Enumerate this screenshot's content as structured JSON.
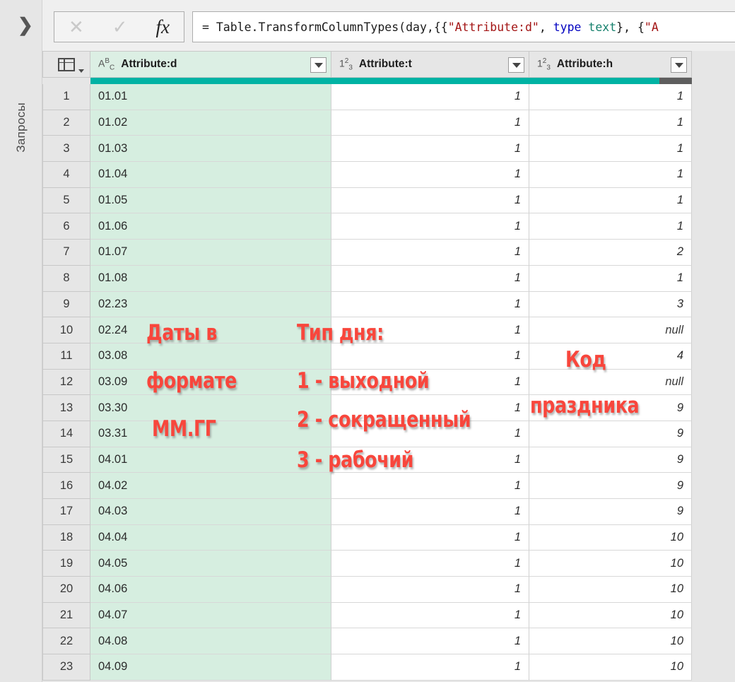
{
  "sidebar": {
    "expand_icon": "chevron-right-icon",
    "label": "Запросы"
  },
  "formula_bar": {
    "cancel_icon": "close-icon",
    "accept_icon": "check-icon",
    "fx_icon": "fx-icon",
    "formula_segments": [
      {
        "text": "= Table.TransformColumnTypes(day,{{",
        "style": "plain"
      },
      {
        "text": "\"Attribute:d\"",
        "style": "string"
      },
      {
        "text": ", ",
        "style": "plain"
      },
      {
        "text": "type",
        "style": "keyword"
      },
      {
        "text": " ",
        "style": "plain"
      },
      {
        "text": "text",
        "style": "type"
      },
      {
        "text": "}, {",
        "style": "plain"
      },
      {
        "text": "\"A",
        "style": "string"
      }
    ],
    "formula_full": "= Table.TransformColumnTypes(day,{{\"Attribute:d\", type text}, {\"A"
  },
  "table": {
    "select_all_icon": "table-select-all-icon",
    "columns": [
      {
        "name": "Attribute:d",
        "type_icon": "ABC",
        "type": "text",
        "selected": true,
        "quality_fill_pct": 100,
        "filter_icon": "filter-dropdown-icon"
      },
      {
        "name": "Attribute:t",
        "type_icon": "123",
        "type": "number",
        "selected": false,
        "quality_fill_pct": 100,
        "filter_icon": "filter-dropdown-icon"
      },
      {
        "name": "Attribute:h",
        "type_icon": "123",
        "type": "number",
        "selected": false,
        "quality_fill_pct": 80,
        "filter_icon": "filter-dropdown-icon"
      }
    ],
    "rows": [
      {
        "n": "1",
        "d": "01.01",
        "t": "1",
        "h": "1"
      },
      {
        "n": "2",
        "d": "01.02",
        "t": "1",
        "h": "1"
      },
      {
        "n": "3",
        "d": "01.03",
        "t": "1",
        "h": "1"
      },
      {
        "n": "4",
        "d": "01.04",
        "t": "1",
        "h": "1"
      },
      {
        "n": "5",
        "d": "01.05",
        "t": "1",
        "h": "1"
      },
      {
        "n": "6",
        "d": "01.06",
        "t": "1",
        "h": "1"
      },
      {
        "n": "7",
        "d": "01.07",
        "t": "1",
        "h": "2"
      },
      {
        "n": "8",
        "d": "01.08",
        "t": "1",
        "h": "1"
      },
      {
        "n": "9",
        "d": "02.23",
        "t": "1",
        "h": "3"
      },
      {
        "n": "10",
        "d": "02.24",
        "t": "1",
        "h": "null"
      },
      {
        "n": "11",
        "d": "03.08",
        "t": "1",
        "h": "4"
      },
      {
        "n": "12",
        "d": "03.09",
        "t": "1",
        "h": "null"
      },
      {
        "n": "13",
        "d": "03.30",
        "t": "1",
        "h": "9"
      },
      {
        "n": "14",
        "d": "03.31",
        "t": "1",
        "h": "9"
      },
      {
        "n": "15",
        "d": "04.01",
        "t": "1",
        "h": "9"
      },
      {
        "n": "16",
        "d": "04.02",
        "t": "1",
        "h": "9"
      },
      {
        "n": "17",
        "d": "04.03",
        "t": "1",
        "h": "9"
      },
      {
        "n": "18",
        "d": "04.04",
        "t": "1",
        "h": "10"
      },
      {
        "n": "19",
        "d": "04.05",
        "t": "1",
        "h": "10"
      },
      {
        "n": "20",
        "d": "04.06",
        "t": "1",
        "h": "10"
      },
      {
        "n": "21",
        "d": "04.07",
        "t": "1",
        "h": "10"
      },
      {
        "n": "22",
        "d": "04.08",
        "t": "1",
        "h": "10"
      },
      {
        "n": "23",
        "d": "04.09",
        "t": "1",
        "h": "10"
      }
    ]
  },
  "annotations": [
    {
      "id": "dates",
      "lines": [
        "Даты в",
        "формате",
        "ММ.ГГ"
      ],
      "line1": "Даты в",
      "line2": "формате",
      "line3": "ММ.ГГ"
    },
    {
      "id": "daytype",
      "lines": [
        "Тип дня:",
        "1 - выходной",
        "2 - сокращенный",
        "3 - рабочий"
      ],
      "line1": "Тип дня:",
      "line2": "1 - выходной",
      "line3": "2 - сокращенный",
      "line4": "3 - рабочий"
    },
    {
      "id": "holiday",
      "lines": [
        "Код",
        "праздника"
      ],
      "line1": "Код",
      "line2": "праздника"
    }
  ],
  "colors": {
    "accent_teal": "#00B3A4",
    "null_gray": "#5E5E5E",
    "selected_column": "#D6EEE0",
    "annotation_red": "#F8463C",
    "chrome_gray": "#E6E6E6"
  }
}
